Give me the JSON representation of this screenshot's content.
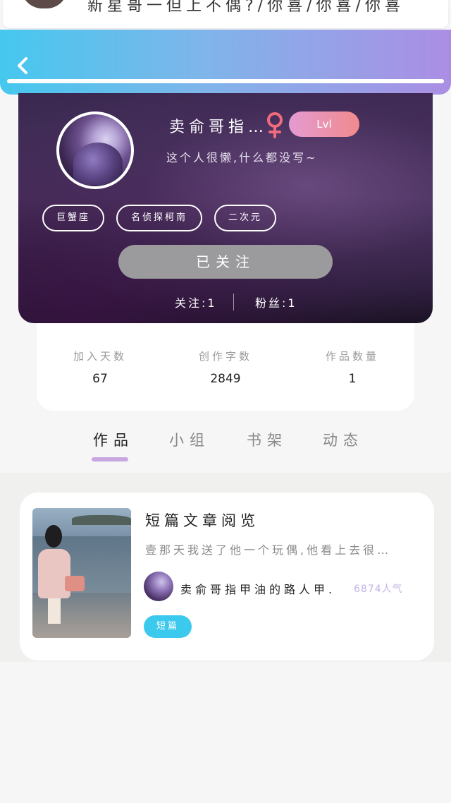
{
  "top_card": {
    "text": "新星哥一但上不偶?/你喜/你喜/你喜"
  },
  "header": {
    "back_icon": "chevron-left-icon",
    "gradient_colors": [
      "#45c8ee",
      "#ab8ee4"
    ]
  },
  "profile": {
    "username": "卖俞哥指…",
    "gender_icon": "female-icon",
    "gender_color": "#f26b7d",
    "level": "Lvl",
    "bio": "这个人很懒,什么都没写~",
    "tags": [
      "巨蟹座",
      "名侦探柯南",
      "二次元"
    ],
    "follow_button": "已关注",
    "following": "关注:1",
    "fans": "粉丝:1"
  },
  "stats": [
    {
      "label": "加入天数",
      "value": "67"
    },
    {
      "label": "创作字数",
      "value": "2849"
    },
    {
      "label": "作品数量",
      "value": "1"
    }
  ],
  "tabs": [
    {
      "label": "作品",
      "active": true
    },
    {
      "label": "小组",
      "active": false
    },
    {
      "label": "书架",
      "active": false
    },
    {
      "label": "动态",
      "active": false
    }
  ],
  "tab_indicator_color": "#c8a7e0",
  "works": [
    {
      "title": "短篇文章阅览",
      "excerpt": "壹那天我送了他一个玩偶,他看上去很…",
      "author": "卖俞哥指甲油的路人甲.",
      "popularity": "6874人气",
      "tag": "短篇",
      "tag_color": "#3cc9ee"
    }
  ]
}
